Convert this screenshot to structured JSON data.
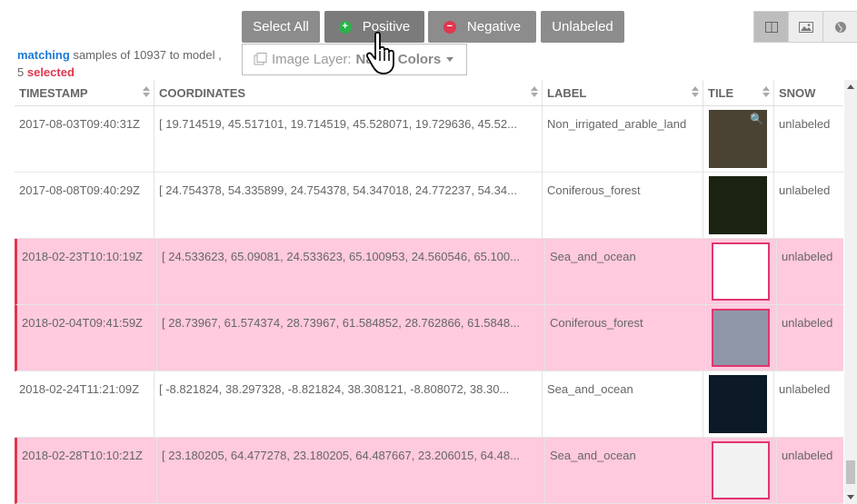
{
  "toolbar": {
    "select_all": "Select All",
    "positive": "Positive",
    "negative": "Negative",
    "unlabeled": "Unlabeled",
    "positive_symbol": "+",
    "negative_symbol": "−"
  },
  "view_buttons": [
    "columns-icon",
    "image-icon",
    "globe-icon"
  ],
  "status": {
    "matching": "matching",
    "text": " samples of 10937 to model ,",
    "count": "5",
    "selected": "selected"
  },
  "image_layer": {
    "key": "Image Layer:",
    "value": "Na",
    "value2": "Colors"
  },
  "columns": [
    "TIMESTAMP",
    "COORDINATES",
    "LABEL",
    "TILE",
    "SNOW"
  ],
  "rows": [
    {
      "timestamp": "2017-08-03T09:40:31Z",
      "coordinates": "[ 19.714519, 45.517101, 19.714519, 45.528071, 19.729636, 45.52...",
      "label": "Non_irrigated_arable_land",
      "snow": "unlabeled",
      "selected": false,
      "tile_color": "#4a4233"
    },
    {
      "timestamp": "2017-08-08T09:40:29Z",
      "coordinates": "[ 24.754378, 54.335899, 24.754378, 54.347018, 24.772237, 54.34...",
      "label": "Coniferous_forest",
      "snow": "unlabeled",
      "selected": false,
      "tile_color": "#1b2212"
    },
    {
      "timestamp": "2018-02-23T10:10:19Z",
      "coordinates": "[ 24.533623, 65.09081, 24.533623, 65.100953, 24.560546, 65.100...",
      "label": "Sea_and_ocean",
      "snow": "unlabeled",
      "selected": true,
      "tile_color": "#ffffff"
    },
    {
      "timestamp": "2018-02-04T09:41:59Z",
      "coordinates": "[ 28.73967, 61.574374, 28.73967, 61.584852, 28.762866, 61.5848...",
      "label": "Coniferous_forest",
      "snow": "unlabeled",
      "selected": true,
      "tile_color": "#8f96a8"
    },
    {
      "timestamp": "2018-02-24T11:21:09Z",
      "coordinates": "[ -8.821824, 38.297328, -8.821824, 38.308121, -8.808072, 38.30...",
      "label": "Sea_and_ocean",
      "snow": "unlabeled",
      "selected": false,
      "tile_color": "#0c1a27"
    },
    {
      "timestamp": "2018-02-28T10:10:21Z",
      "coordinates": "[ 23.180205, 64.477278, 23.180205, 64.487667, 23.206015, 64.48...",
      "label": "Sea_and_ocean",
      "snow": "unlabeled",
      "selected": true,
      "tile_color": "#f2f2f2"
    }
  ]
}
